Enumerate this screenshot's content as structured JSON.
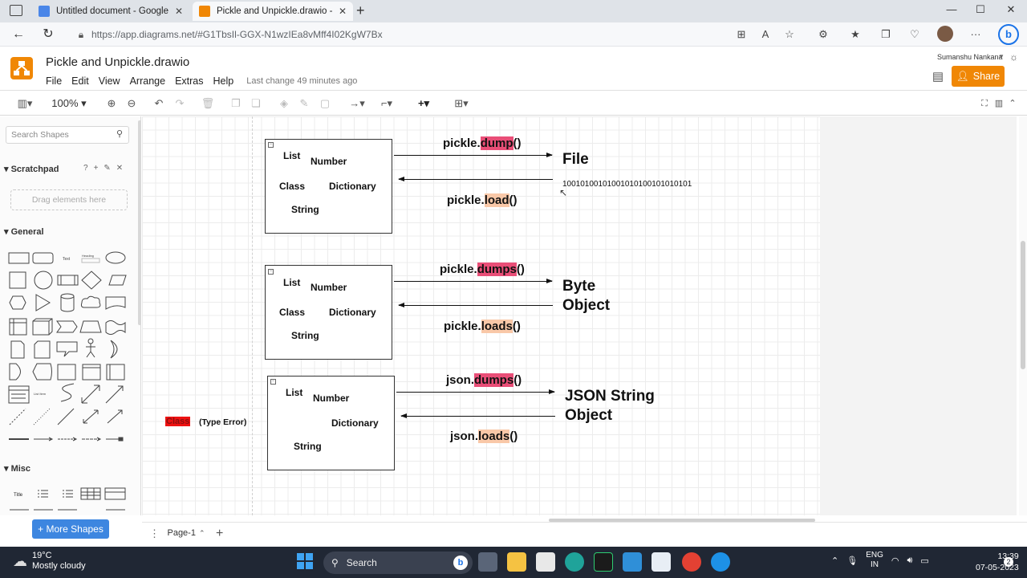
{
  "browser": {
    "tabs": [
      {
        "title": "Untitled document - Google Doc",
        "active": false,
        "favicon_color": "#4a86e8"
      },
      {
        "title": "Pickle and Unpickle.drawio - diag",
        "active": true,
        "favicon_color": "#f08705"
      }
    ],
    "new_tab": "+",
    "url": "https://app.diagrams.net/#G1TbsIl-GGX-N1wzIEa8vMff4I02KgW7Bx"
  },
  "app": {
    "doc_title": "Pickle and Unpickle.drawio",
    "menus": [
      "File",
      "Edit",
      "View",
      "Arrange",
      "Extras",
      "Help"
    ],
    "last_change": "Last change 49 minutes ago",
    "user": "Sumanshu Nankana",
    "share_label": "Share",
    "accent": "#f08705"
  },
  "toolbar": {
    "zoom": "100%"
  },
  "sidebar": {
    "search_placeholder": "Search Shapes",
    "scratchpad_title": "Scratchpad",
    "scratchpad_actions": [
      "?",
      "+",
      "✎",
      "✕"
    ],
    "drag_hint": "Drag elements here",
    "general_title": "General",
    "misc_title": "Misc",
    "more_shapes": "More Shapes",
    "shape_text_labels": [
      "Text",
      "Heading",
      "Title",
      "List Item"
    ]
  },
  "diagram": {
    "box_labels": [
      "List",
      "Number",
      "Class",
      "Dictionary",
      "String"
    ],
    "rows": [
      {
        "forward": {
          "prefix": "pickle.",
          "method": "dump",
          "suffix": "()"
        },
        "backward": {
          "prefix": "pickle.",
          "method": "load",
          "suffix": "()"
        },
        "target_line1": "File",
        "target_line2": "",
        "binary": "10010100101001010100101010101"
      },
      {
        "forward": {
          "prefix": "pickle.",
          "method": "dumps",
          "suffix": "()"
        },
        "backward": {
          "prefix": "pickle.",
          "method": "loads",
          "suffix": "()"
        },
        "target_line1": "Byte",
        "target_line2": "Object"
      },
      {
        "forward": {
          "prefix": "json.",
          "method": "dumps",
          "suffix": "()"
        },
        "backward": {
          "prefix": "json.",
          "method": "loads",
          "suffix": "()"
        },
        "target_line1": "JSON String",
        "target_line2": "Object"
      }
    ],
    "side_note": {
      "class_label": "Class",
      "error_label": "(Type Error)"
    }
  },
  "pages": {
    "current": "Page-1"
  },
  "taskbar": {
    "temperature": "19°C",
    "weather": "Mostly cloudy",
    "search_label": "Search",
    "language_line1": "ENG",
    "language_line2": "IN",
    "time": "13:39",
    "date": "07-05-2023",
    "notification_count": "2"
  }
}
